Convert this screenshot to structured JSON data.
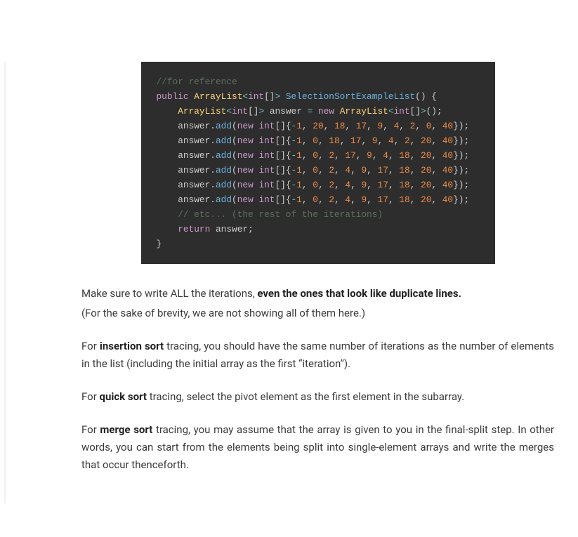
{
  "code": {
    "l1": "//for reference",
    "l2a": "public",
    "l2b": "ArrayList",
    "l2c": "int",
    "l2d": "SelectionSortExampleList",
    "l3a": "ArrayList",
    "l3b": "int",
    "l3c": "answer",
    "l3d": "new",
    "l3e": "ArrayList",
    "l3f": "int",
    "add": "add",
    "newkw": "new",
    "intkw": "int",
    "etc": "// etc... (the rest of the iterations)",
    "ret": "return",
    "ans": "answer",
    "rows": [
      [
        "-1",
        "20",
        "18",
        "17",
        "9",
        "4",
        "2",
        "0",
        "40"
      ],
      [
        "-1",
        "0",
        "18",
        "17",
        "9",
        "4",
        "2",
        "20",
        "40"
      ],
      [
        "-1",
        "0",
        "2",
        "17",
        "9",
        "4",
        "18",
        "20",
        "40"
      ],
      [
        "-1",
        "0",
        "2",
        "4",
        "9",
        "17",
        "18",
        "20",
        "40"
      ],
      [
        "-1",
        "0",
        "2",
        "4",
        "9",
        "17",
        "18",
        "20",
        "40"
      ],
      [
        "-1",
        "0",
        "2",
        "4",
        "9",
        "17",
        "18",
        "20",
        "40"
      ]
    ]
  },
  "p1a": "Make sure to write ALL the iterations, ",
  "p1b": "even the ones that look like duplicate lines.",
  "p1sub": "(For the sake of brevity, we are not showing all of them here.)",
  "p2a": "For ",
  "p2b": "insertion sort",
  "p2c": " tracing, you should have the same number of iterations as the number of elements in the list (including the initial array as the first “iteration”).",
  "p3a": "For ",
  "p3b": "quick sort",
  "p3c": " tracing, select the pivot element as the first element in the subarray.",
  "p4a": "For ",
  "p4b": "merge sort",
  "p4c": " tracing, you may assume that the array is given to you in the final-split step. In other words, you can start from the elements being split into single-element arrays and write the merges that occur thenceforth."
}
